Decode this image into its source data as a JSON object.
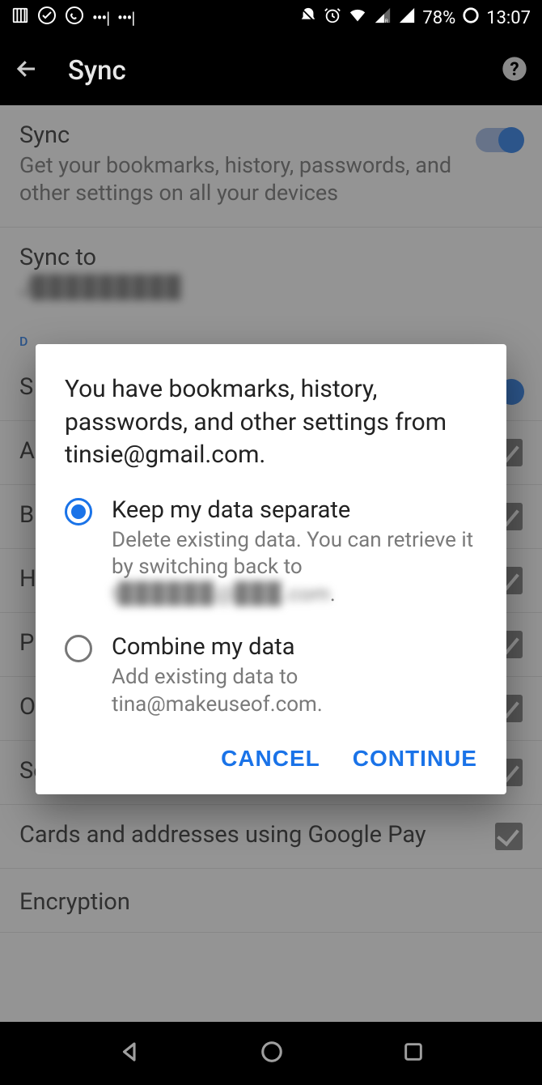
{
  "status": {
    "battery": "78%",
    "time": "13:07"
  },
  "appbar": {
    "title": "Sync"
  },
  "sync_row": {
    "title": "Sync",
    "subtitle": "Get your bookmarks, history, passwords, and other settings on all your devices",
    "toggle_on": true
  },
  "sync_to": {
    "title": "Sync to",
    "account": "J▉▉▉▉▉▉▉▉▉"
  },
  "data_types": {
    "header_partial": "D",
    "sync_everything_label": "S"
  },
  "data_type_items": [
    {
      "label_partial": "A",
      "checked": true
    },
    {
      "label_partial": "B",
      "checked": true
    },
    {
      "label_partial": "H",
      "checked": true
    },
    {
      "label_partial": "P",
      "checked": true
    },
    {
      "label_full": "Open tabs",
      "checked": true
    },
    {
      "label_full": "Settings",
      "checked": true
    },
    {
      "label_full": "Cards and addresses using Google Pay",
      "checked": true
    }
  ],
  "encryption": {
    "title": "Encryption"
  },
  "dialog": {
    "message": "You have bookmarks, history, passwords, and other settings from tinsie@gmail.com.",
    "options": [
      {
        "title": "Keep my data separate",
        "desc_prefix": "Delete existing data. You can retrieve it by switching back to ",
        "desc_redacted": "t▉▉▉▉▉▉@▉▉▉.com",
        "selected": true
      },
      {
        "title": "Combine my data",
        "desc": "Add existing data to tina@makeuseof.com.",
        "selected": false
      }
    ],
    "cancel": "CANCEL",
    "continue": "CONTINUE"
  }
}
